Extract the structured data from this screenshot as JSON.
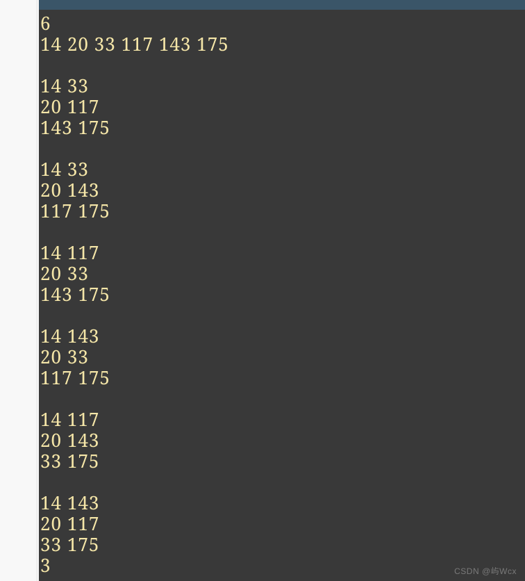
{
  "console": {
    "lines": [
      "6",
      "14 20 33 117 143 175",
      "",
      "14 33",
      "20 117",
      "143 175",
      "",
      "14 33",
      "20 143",
      "117 175",
      "",
      "14 117",
      "20 33",
      "143 175",
      "",
      "14 143",
      "20 33",
      "117 175",
      "",
      "14 117",
      "20 143",
      "33 175",
      "",
      "14 143",
      "20 117",
      "33 175",
      "3"
    ]
  },
  "watermark": "CSDN @屿Wcx"
}
